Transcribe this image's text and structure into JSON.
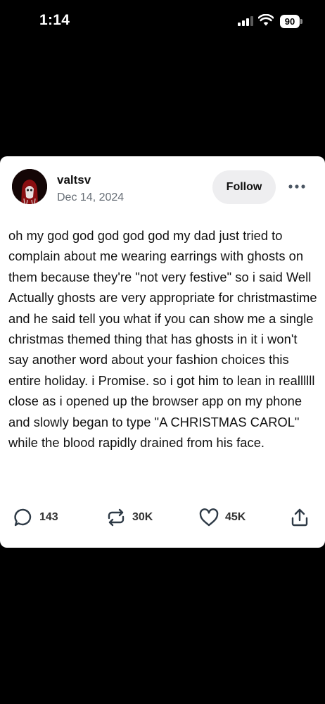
{
  "status_bar": {
    "time": "1:14",
    "battery": "90"
  },
  "post": {
    "username": "valtsv",
    "date": "Dec 14, 2024",
    "follow_label": "Follow",
    "body": "oh my god god god god god my dad just tried to complain about me wearing earrings with ghosts on them because they're \"not very festive\" so i said Well Actually ghosts are very appropriate for christmastime and he said tell you what if you can show me a single christmas themed thing that has ghosts in it i won't say another word about your fashion choices this entire holiday. i Promise. so i got him to lean in reallllll close as i opened up the browser app on my phone and slowly began to type \"A CHRISTMAS CAROL\" while the blood rapidly drained from his face.",
    "actions": {
      "replies": "143",
      "reblogs": "30K",
      "likes": "45K"
    }
  },
  "icons": [
    "signal-icon",
    "wifi-icon",
    "battery-icon",
    "more-icon",
    "comment-icon",
    "reblog-icon",
    "heart-icon",
    "share-icon"
  ]
}
